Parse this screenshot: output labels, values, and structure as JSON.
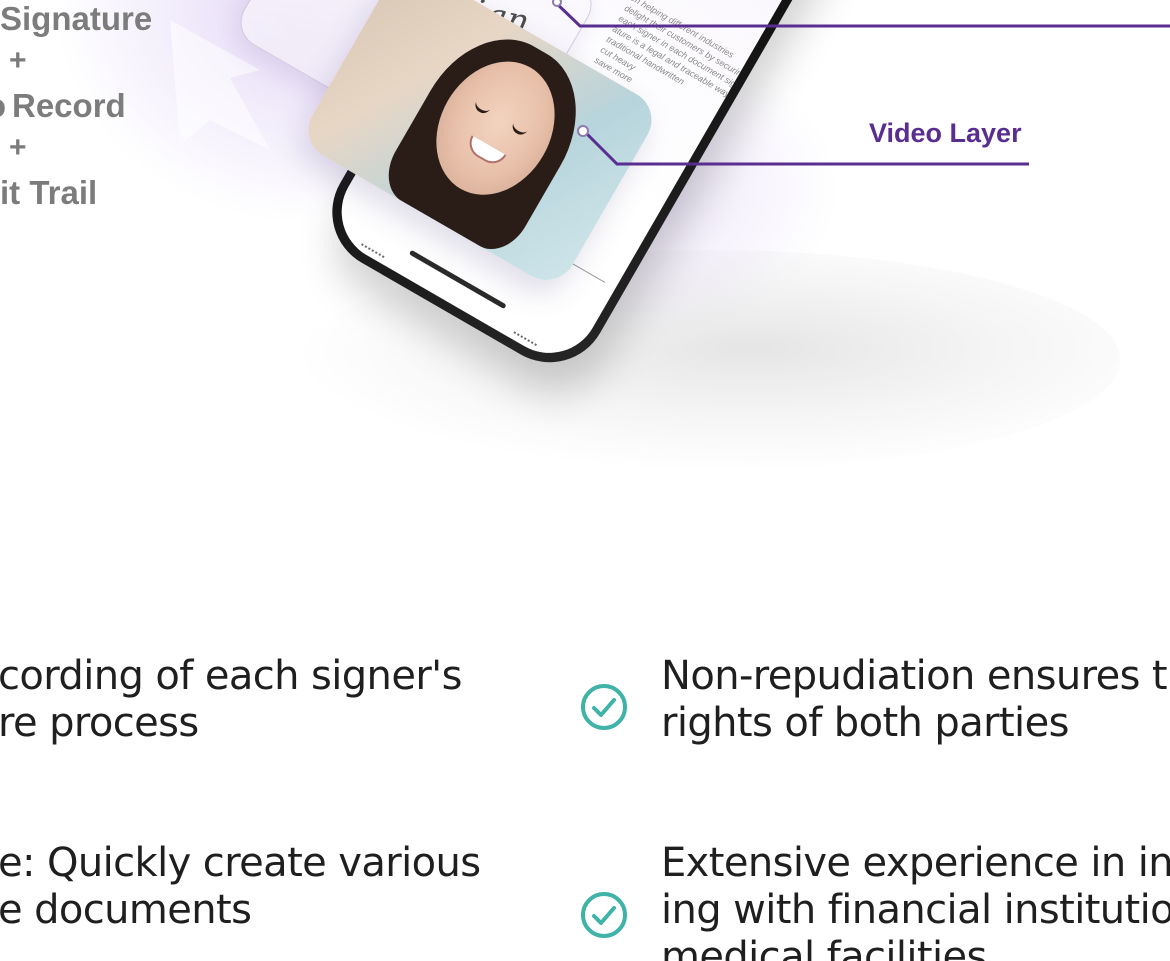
{
  "hero": {
    "formula": {
      "line1": "Signature",
      "plus1": "+",
      "line2": "Record",
      "plus2": "+",
      "line3": "it Trail"
    },
    "signature_text": "fesign",
    "document_lines": [
      "en helping different industries",
      "delight their customers by securing",
      "each signer in each document signed",
      "ature is a legal and traceable way to",
      "traditional handwritten",
      "cut heavy",
      "save more"
    ],
    "video_layer_label": "Video Layer"
  },
  "features": {
    "left": [
      {
        "line1": "cording of each signer's",
        "line2": "re process"
      },
      {
        "line1": "e: Quickly create various",
        "line2": "e documents"
      }
    ],
    "right": [
      {
        "line1": "Non-repudiation ensures th",
        "line2": "rights of both parties"
      },
      {
        "line1": "Extensive experience in inte",
        "line2": "ing with financial institution",
        "line3": "medical facilities"
      }
    ]
  },
  "colors": {
    "accent": "#5a2d91",
    "check": "#3fb3a7",
    "formula_text": "#7c7c7c"
  }
}
